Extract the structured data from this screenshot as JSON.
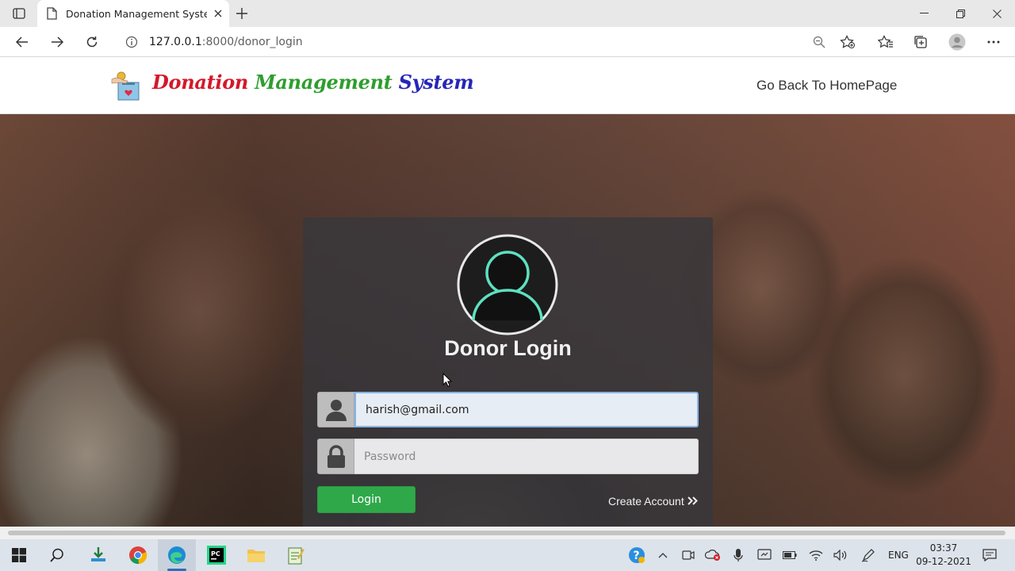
{
  "browser": {
    "tab_title": "Donation Management System",
    "url_host": "127.0.0.1",
    "url_rest": ":8000/donor_login"
  },
  "site": {
    "brand_word1": "Donation",
    "brand_word2": "Management",
    "brand_word3": "System",
    "home_link": "Go Back To HomePage"
  },
  "login": {
    "title": "Donor Login",
    "email_value": "harish@gmail.com",
    "password_placeholder": "Password",
    "login_button": "Login",
    "create_account": "Create Account"
  },
  "taskbar": {
    "lang": "ENG",
    "time": "03:37",
    "date": "09-12-2021"
  },
  "colors": {
    "brand_red": "#d4182a",
    "brand_green": "#2e9e2e",
    "brand_blue": "#2626b8",
    "login_green": "#2fa84a",
    "avatar_teal": "#5fe0c0"
  }
}
